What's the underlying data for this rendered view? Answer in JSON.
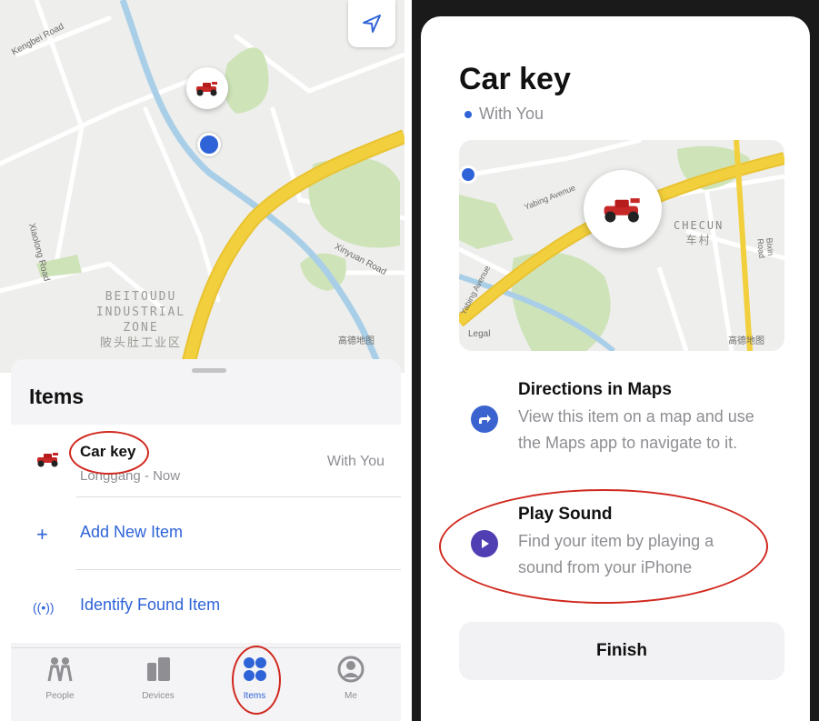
{
  "left": {
    "map": {
      "district_label_en": [
        "BEITOUDU",
        "INDUSTRIAL",
        "ZONE"
      ],
      "district_label_cn": "陂头肚工业区",
      "road_label_1": "Kengbei Road",
      "road_label_2": "Xinyuan Road",
      "road_label_3": "Xiaolong Road",
      "legal_mark": "高德地图"
    },
    "sheet": {
      "title": "Items",
      "items": [
        {
          "name": "Car key",
          "subtitle": "Longgang - Now",
          "status": "With You"
        }
      ],
      "actions": [
        {
          "icon": "+",
          "label": "Add New Item"
        },
        {
          "icon": "((•))",
          "label": "Identify Found Item"
        }
      ]
    },
    "tabs": [
      {
        "label": "People",
        "icon": "people-icon"
      },
      {
        "label": "Devices",
        "icon": "devices-icon"
      },
      {
        "label": "Items",
        "icon": "items-icon",
        "active": true
      },
      {
        "label": "Me",
        "icon": "me-icon"
      }
    ]
  },
  "right": {
    "title": "Car key",
    "subtitle": "With You",
    "map": {
      "street_1": "Yabing Avenue",
      "street_2": "Yabing Avenue",
      "village_en": "CHECUN",
      "village_cn": "车村",
      "road_right": "Bixin Road",
      "legal": "Legal",
      "legal_mark": "高德地图"
    },
    "options": [
      {
        "title": "Directions in Maps",
        "description": "View this item on a map and use the Maps app to navigate to it.",
        "icon": "directions-arrow-icon"
      },
      {
        "title": "Play Sound",
        "description": "Find your item by playing a sound from your iPhone",
        "icon": "play-icon"
      }
    ],
    "finish_label": "Finish"
  },
  "colors": {
    "accent": "#2f63d8",
    "highway": "#f2cf3c",
    "park": "#cfe3b9",
    "water": "#a9cfe8",
    "highlight": "#d0281e"
  }
}
